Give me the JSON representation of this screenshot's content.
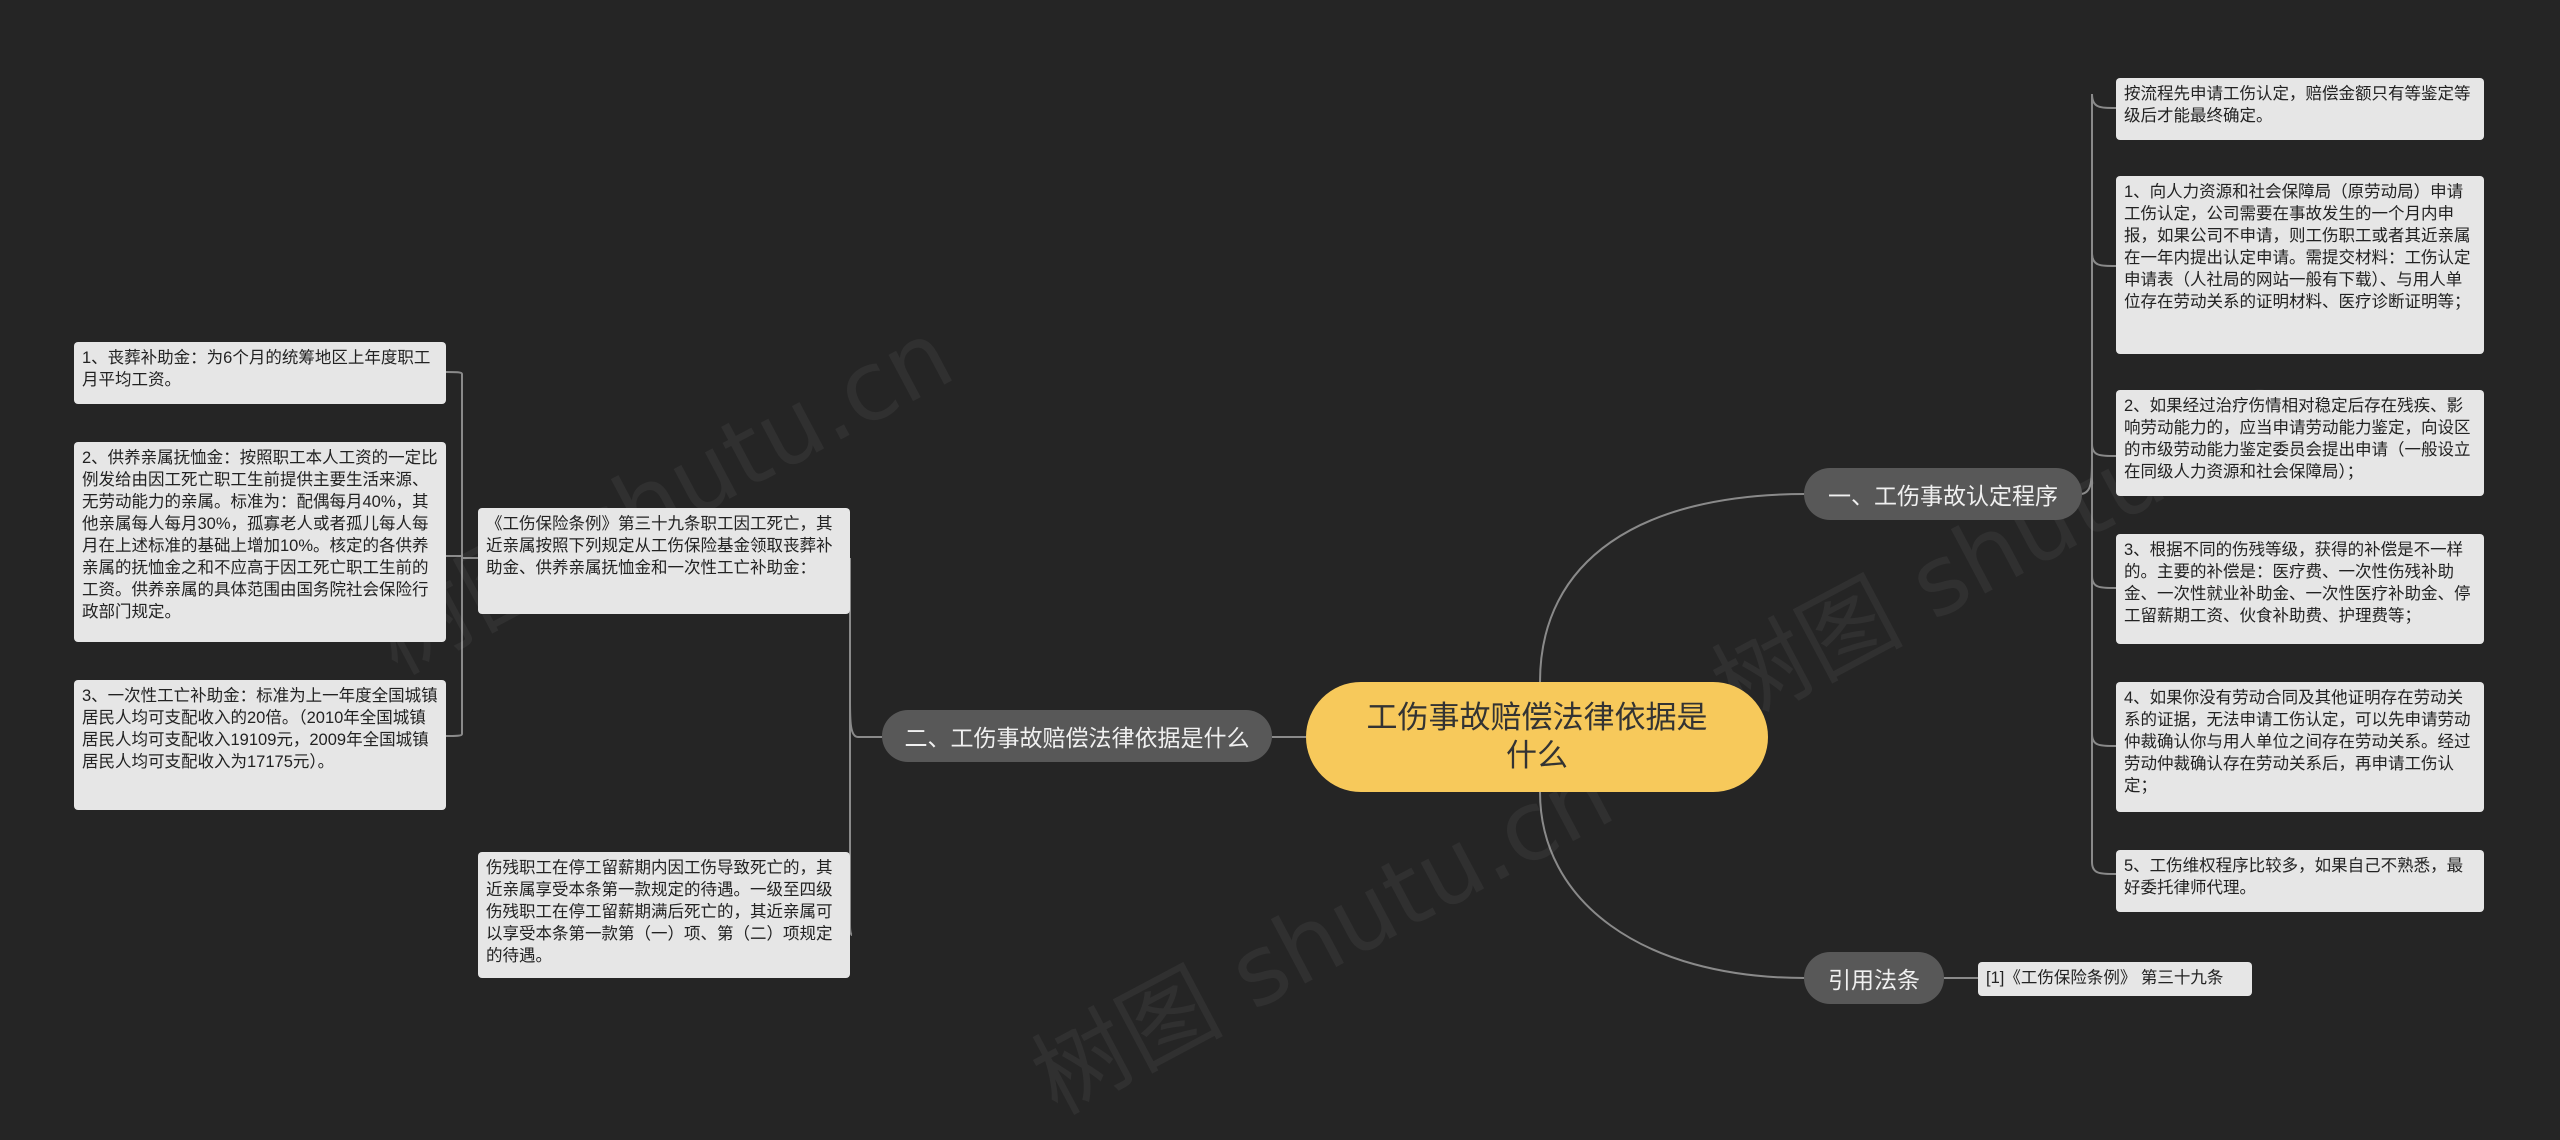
{
  "root": {
    "label": "工伤事故赔偿法律依据是什么"
  },
  "branches": {
    "procedure": {
      "label": "一、工伤事故认定程序",
      "items": [
        "按流程先申请工伤认定，赔偿金额只有等鉴定等级后才能最终确定。",
        "1、向人力资源和社会保障局（原劳动局）申请工伤认定，公司需要在事故发生的一个月内申报，如果公司不申请，则工伤职工或者其近亲属在一年内提出认定申请。需提交材料：工伤认定申请表（人社局的网站一般有下载）、与用人单位存在劳动关系的证明材料、医疗诊断证明等；",
        "2、如果经过治疗伤情相对稳定后存在残疾、影响劳动能力的，应当申请劳动能力鉴定，向设区的市级劳动能力鉴定委员会提出申请（一般设立在同级人力资源和社会保障局）；",
        "3、根据不同的伤残等级，获得的补偿是不一样的。主要的补偿是：医疗费、一次性伤残补助金、一次性就业补助金、一次性医疗补助金、停工留薪期工资、伙食补助费、护理费等；",
        "4、如果你没有劳动合同及其他证明存在劳动关系的证据，无法申请工伤认定，可以先申请劳动仲裁确认你与用人单位之间存在劳动关系。经过劳动仲裁确认存在劳动关系后，再申请工伤认定；",
        "5、工伤维权程序比较多，如果自己不熟悉，最好委托律师代理。"
      ]
    },
    "legal": {
      "label": "二、工伤事故赔偿法律依据是什么",
      "article": "《工伤保险条例》第三十九条职工因工死亡，其近亲属按照下列规定从工伤保险基金领取丧葬补助金、供养亲属抚恤金和一次性工亡补助金：",
      "subitems": [
        "1、丧葬补助金：为6个月的统筹地区上年度职工月平均工资。",
        "2、供养亲属抚恤金：按照职工本人工资的一定比例发给由因工死亡职工生前提供主要生活来源、无劳动能力的亲属。标准为：配偶每月40%，其他亲属每人每月30%，孤寡老人或者孤儿每人每月在上述标准的基础上增加10%。核定的各供养亲属的抚恤金之和不应高于因工死亡职工生前的工资。供养亲属的具体范围由国务院社会保险行政部门规定。",
        "3、一次性工亡补助金：标准为上一年度全国城镇居民人均可支配收入的20倍。（2010年全国城镇居民人均可支配收入19109元，2009年全国城镇居民人均可支配收入为17175元）。"
      ],
      "note": "伤残职工在停工留薪期内因工伤导致死亡的，其近亲属享受本条第一款规定的待遇。一级至四级伤残职工在停工留薪期满后死亡的，其近亲属可以享受本条第一款第（一）项、第（二）项规定的待遇。"
    },
    "citation": {
      "label": "引用法条",
      "item": "[1]《工伤保险条例》 第三十九条"
    }
  },
  "watermarks": [
    "树图 shutu.cn",
    "树图 shutu.cn",
    "树图 shutu.cn"
  ],
  "colors": {
    "background": "#252525",
    "root": "#f7c95b",
    "branch": "#585858",
    "leaf": "#e6e6e6",
    "line": "#8a8a8a"
  }
}
